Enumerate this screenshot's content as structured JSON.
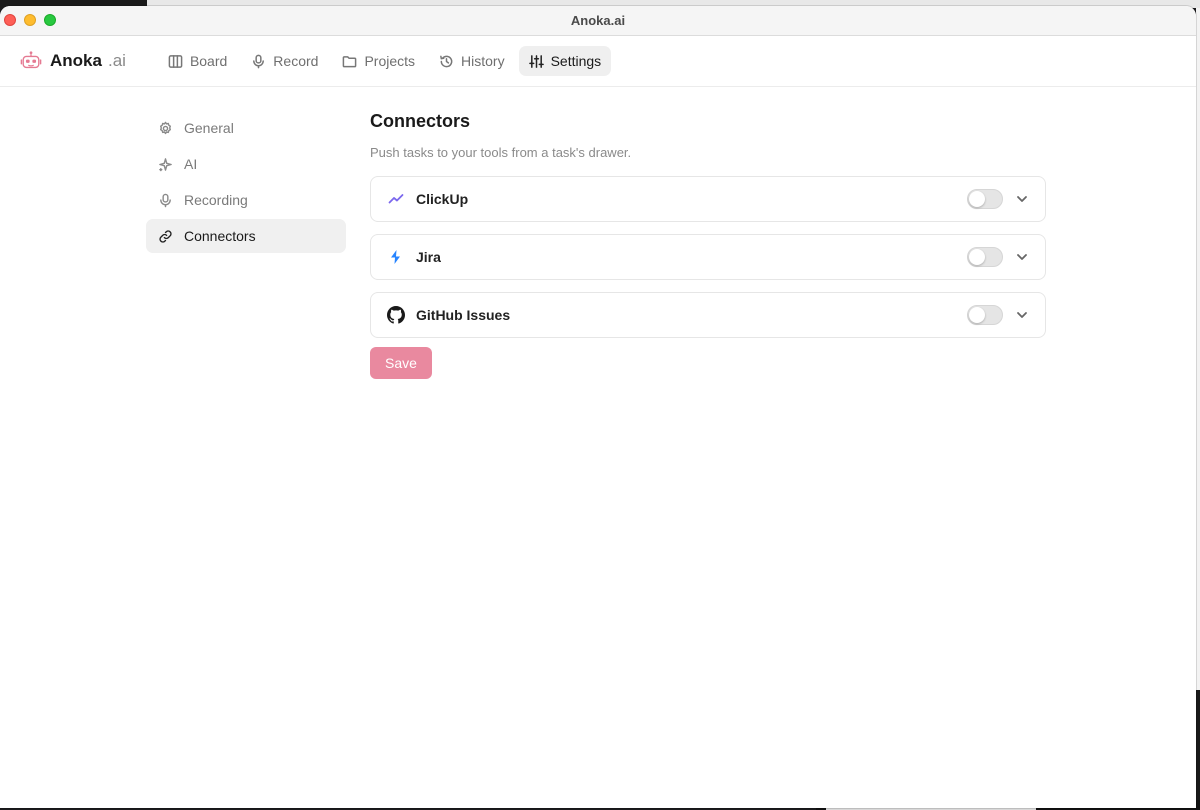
{
  "window": {
    "title": "Anoka.ai"
  },
  "brand": {
    "name": "Anoka",
    "suffix": ".ai",
    "logo_icon": "robot-logo-icon"
  },
  "nav": {
    "tabs": [
      {
        "label": "Board",
        "icon": "columns-icon",
        "active": false
      },
      {
        "label": "Record",
        "icon": "microphone-icon",
        "active": false
      },
      {
        "label": "Projects",
        "icon": "folder-icon",
        "active": false
      },
      {
        "label": "History",
        "icon": "history-icon",
        "active": false
      },
      {
        "label": "Settings",
        "icon": "sliders-icon",
        "active": true
      }
    ]
  },
  "sidebar": {
    "items": [
      {
        "label": "General",
        "icon": "gear-icon",
        "active": false
      },
      {
        "label": "AI",
        "icon": "sparkle-icon",
        "active": false
      },
      {
        "label": "Recording",
        "icon": "microphone-icon",
        "active": false
      },
      {
        "label": "Connectors",
        "icon": "link-icon",
        "active": true
      }
    ]
  },
  "main": {
    "title": "Connectors",
    "subtitle": "Push tasks to your tools from a task's drawer.",
    "connectors": [
      {
        "name": "ClickUp",
        "icon": "clickup-icon",
        "enabled": false
      },
      {
        "name": "Jira",
        "icon": "jira-icon",
        "enabled": false
      },
      {
        "name": "GitHub Issues",
        "icon": "github-icon",
        "enabled": false
      }
    ],
    "save_label": "Save"
  },
  "colors": {
    "accent": "#e9899f",
    "active_bg": "#efefef",
    "clickup": "#7b68ee",
    "jira": "#2684ff"
  }
}
